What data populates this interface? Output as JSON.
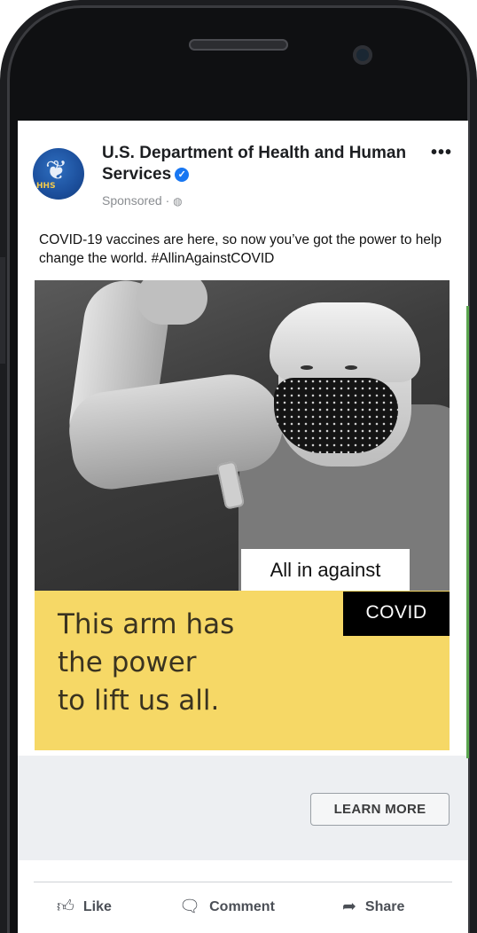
{
  "post": {
    "page_name": "U.S. Department of Health and Human Services",
    "verified_icon": "verified-badge-icon",
    "sponsored": "Sponsored ·",
    "more": "•••",
    "avatar_text": "HHS",
    "caption": "COVID-19 vaccines are here, so now you’ve got the power to help change the world. #AllinAgainstCOVID"
  },
  "ad": {
    "label_line1": "All in against",
    "label_line2": "COVID",
    "headline": [
      "This arm has",
      "the power",
      "to lift us all."
    ],
    "cta": "LEARN MORE"
  },
  "actions": {
    "like": "Like",
    "comment": "Comment",
    "share": "Share"
  },
  "colors": {
    "accent_blue": "#1877f2",
    "ad_yellow": "#f6d866"
  }
}
